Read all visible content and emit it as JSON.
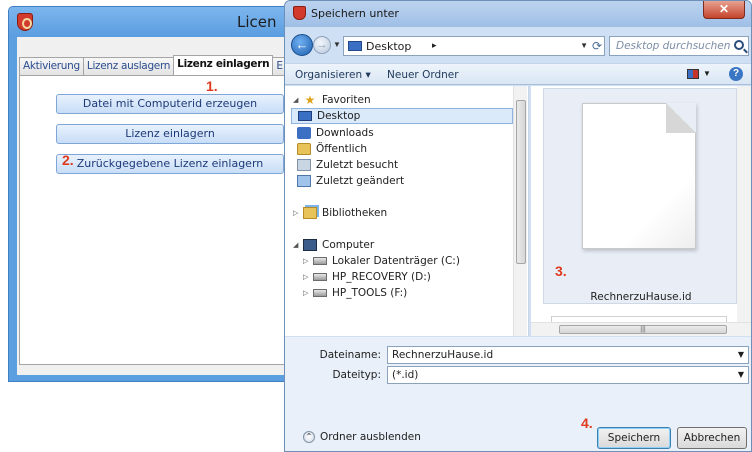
{
  "background_app": {
    "title": "Licen",
    "tabs": [
      "Aktivierung",
      "Lizenz auslagern",
      "Lizenz einlagern",
      "E"
    ],
    "active_tab": "Lizenz einlagern",
    "buttons": {
      "create_file": "Datei mit Computerid erzeugen",
      "import_license": "Lizenz einlagern",
      "import_returned": "Zurückgegebene Lizenz einlagern"
    }
  },
  "markers": {
    "m1": "1.",
    "m2": "2.",
    "m3": "3.",
    "m4": "4."
  },
  "dialog": {
    "title": "Speichern unter",
    "close_label": "✕",
    "address": {
      "location": "Desktop",
      "chevron": "▸"
    },
    "search_placeholder": "Desktop durchsuchen",
    "toolbar": {
      "organize": "Organisieren ▾",
      "new_folder": "Neuer Ordner"
    },
    "nav": {
      "favorites": "Favoriten",
      "desktop": "Desktop",
      "downloads": "Downloads",
      "public": "Öffentlich",
      "recent": "Zuletzt besucht",
      "changed": "Zuletzt geändert",
      "libraries": "Bibliotheken",
      "computer": "Computer",
      "drive_c": "Lokaler Datenträger (C:)",
      "drive_d": "HP_RECOVERY (D:)",
      "drive_f": "HP_TOOLS (F:)"
    },
    "file": {
      "name": "RechnerzuHause.id"
    },
    "form": {
      "filename_label": "Dateiname:",
      "filename_value": "RechnerzuHause.id",
      "filetype_label": "Dateityp:",
      "filetype_value": "(*.id)"
    },
    "footer": {
      "hide_folders": "Ordner ausblenden",
      "save": "Speichern",
      "cancel": "Abbrechen"
    }
  }
}
